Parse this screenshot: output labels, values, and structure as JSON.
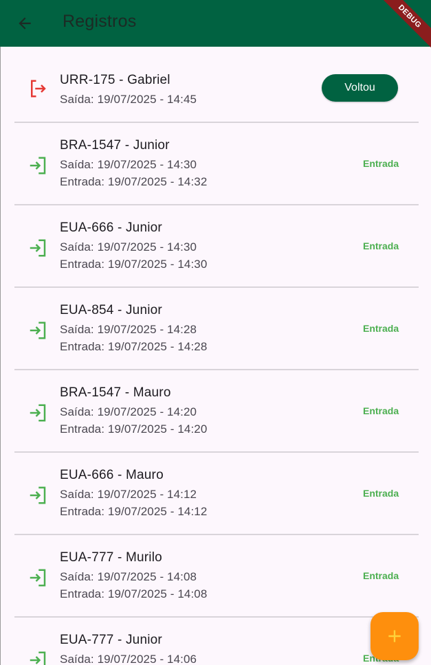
{
  "appbar": {
    "title": "Registros",
    "debug_label": "DEBUG",
    "color": "#016241"
  },
  "records": [
    {
      "plate": "URR-175 - Gabriel",
      "saida": "Saída: 19/07/2025 - 14:45",
      "entrada": null,
      "status": "out",
      "action_label": "Voltou",
      "icon": "exit-icon"
    },
    {
      "plate": "BRA-1547 - Junior",
      "saida": "Saída: 19/07/2025 - 14:30",
      "entrada": "Entrada: 19/07/2025 - 14:32",
      "status": "Entrada",
      "icon": "login-icon"
    },
    {
      "plate": "EUA-666 - Junior",
      "saida": "Saída: 19/07/2025 - 14:30",
      "entrada": "Entrada: 19/07/2025 - 14:30",
      "status": "Entrada",
      "icon": "login-icon"
    },
    {
      "plate": "EUA-854 - Junior",
      "saida": "Saída: 19/07/2025 - 14:28",
      "entrada": "Entrada: 19/07/2025 - 14:28",
      "status": "Entrada",
      "icon": "login-icon"
    },
    {
      "plate": "BRA-1547 - Mauro",
      "saida": "Saída: 19/07/2025 - 14:20",
      "entrada": "Entrada: 19/07/2025 - 14:20",
      "status": "Entrada",
      "icon": "login-icon"
    },
    {
      "plate": "EUA-666 - Mauro",
      "saida": "Saída: 19/07/2025 - 14:12",
      "entrada": "Entrada: 19/07/2025 - 14:12",
      "status": "Entrada",
      "icon": "login-icon"
    },
    {
      "plate": "EUA-777 - Murilo",
      "saida": "Saída: 19/07/2025 - 14:08",
      "entrada": "Entrada: 19/07/2025 - 14:08",
      "status": "Entrada",
      "icon": "login-icon"
    },
    {
      "plate": "EUA-777 - Junior",
      "saida": "Saída: 19/07/2025 - 14:06",
      "entrada": null,
      "status": "Entrada",
      "icon": "login-icon"
    }
  ],
  "fab": {
    "icon": "plus-icon",
    "color": "#fe8f0d"
  },
  "colors": {
    "exit": "#e53935",
    "entry": "#4caf50"
  }
}
